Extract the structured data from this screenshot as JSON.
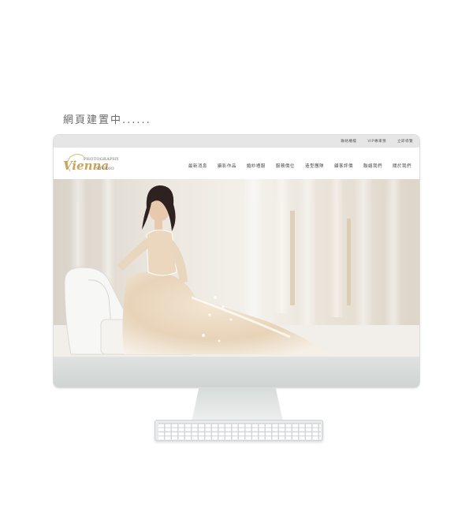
{
  "headline": "網頁建置中......",
  "website": {
    "topbar_links": [
      "聯絡櫃檯",
      "VIP專車預",
      "立即導覽"
    ],
    "logo": {
      "script": "Vienna",
      "line1": "PHOTOGRAPHY",
      "line2": "STUDIO"
    },
    "nav": [
      "最新消息",
      "攝影作品",
      "婚紗禮服",
      "服務價位",
      "造型團隊",
      "顧客評價",
      "聯絡我們",
      "關於我們"
    ]
  },
  "colors": {
    "gold": "#c9a45b",
    "bezel": "#e9ebea",
    "topbar": "#e6e6e6"
  }
}
